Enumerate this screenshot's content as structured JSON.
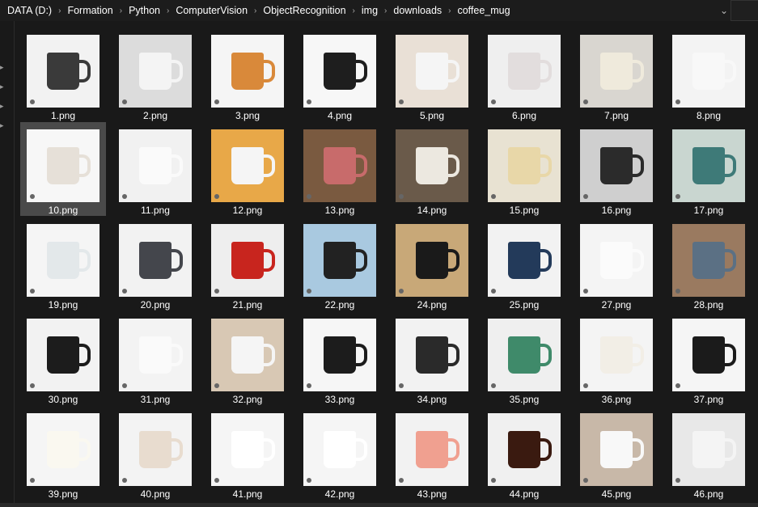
{
  "address_bar": {
    "breadcrumbs": [
      "DATA (D:)",
      "Formation",
      "Python",
      "ComputerVision",
      "ObjectRecognition",
      "img",
      "downloads",
      "coffee_mug"
    ],
    "dropdown_icon": "chevron-down-icon",
    "refresh_icon": "refresh-icon"
  },
  "selected": "10.png",
  "files": [
    {
      "name": "1.png",
      "bg": "#f2f2f2",
      "mug": "#3a3a3a"
    },
    {
      "name": "2.png",
      "bg": "#dcdcdc",
      "mug": "#f4f4f4"
    },
    {
      "name": "3.png",
      "bg": "#f5f5f5",
      "mug": "#d9893a"
    },
    {
      "name": "4.png",
      "bg": "#f7f7f7",
      "mug": "#1e1e1e"
    },
    {
      "name": "5.png",
      "bg": "#e9e0d6",
      "mug": "#f5f5f5"
    },
    {
      "name": "6.png",
      "bg": "#efefef",
      "mug": "#e2dddd"
    },
    {
      "name": "7.png",
      "bg": "#d9d6d0",
      "mug": "#efeadc"
    },
    {
      "name": "8.png",
      "bg": "#f3f3f3",
      "mug": "#f8f8f8"
    },
    {
      "name": "10.png",
      "bg": "#f7f7f7",
      "mug": "#e6e0d8"
    },
    {
      "name": "11.png",
      "bg": "#f1f1f1",
      "mug": "#fafafa"
    },
    {
      "name": "12.png",
      "bg": "#e8a848",
      "mug": "#f5f5f5"
    },
    {
      "name": "13.png",
      "bg": "#7a5a40",
      "mug": "#c86b6b"
    },
    {
      "name": "14.png",
      "bg": "#6a5a4a",
      "mug": "#ece8e0"
    },
    {
      "name": "15.png",
      "bg": "#e8e2d2",
      "mug": "#e8d7a8"
    },
    {
      "name": "16.png",
      "bg": "#cfcfcf",
      "mug": "#2b2b2b"
    },
    {
      "name": "17.png",
      "bg": "#c9d6d0",
      "mug": "#3e7a78"
    },
    {
      "name": "19.png",
      "bg": "#f5f5f5",
      "mug": "#e3e8ea"
    },
    {
      "name": "20.png",
      "bg": "#f2f2f2",
      "mug": "#44464c"
    },
    {
      "name": "21.png",
      "bg": "#eeeeee",
      "mug": "#c8251e"
    },
    {
      "name": "22.png",
      "bg": "#a9c9e0",
      "mug": "#222222"
    },
    {
      "name": "24.png",
      "bg": "#c8a878",
      "mug": "#1a1a1a"
    },
    {
      "name": "25.png",
      "bg": "#f2f2f2",
      "mug": "#233a5a"
    },
    {
      "name": "27.png",
      "bg": "#f4f4f4",
      "mug": "#fbfbfb"
    },
    {
      "name": "28.png",
      "bg": "#9a7a60",
      "mug": "#5b7084"
    },
    {
      "name": "30.png",
      "bg": "#f2f2f2",
      "mug": "#1c1c1c"
    },
    {
      "name": "31.png",
      "bg": "#f3f3f3",
      "mug": "#fafafa"
    },
    {
      "name": "32.png",
      "bg": "#d8c8b4",
      "mug": "#f5f5f5"
    },
    {
      "name": "33.png",
      "bg": "#f6f6f6",
      "mug": "#1c1c1c"
    },
    {
      "name": "34.png",
      "bg": "#f2f2f2",
      "mug": "#2a2a2a"
    },
    {
      "name": "35.png",
      "bg": "#efefef",
      "mug": "#3f8a6a"
    },
    {
      "name": "36.png",
      "bg": "#f4f4f4",
      "mug": "#f2eee6"
    },
    {
      "name": "37.png",
      "bg": "#f5f5f5",
      "mug": "#1b1b1b"
    },
    {
      "name": "39.png",
      "bg": "#f5f5f5",
      "mug": "#faf8f0"
    },
    {
      "name": "40.png",
      "bg": "#f3f3f3",
      "mug": "#e8dccf"
    },
    {
      "name": "41.png",
      "bg": "#f5f5f5",
      "mug": "#ffffff"
    },
    {
      "name": "42.png",
      "bg": "#f5f5f5",
      "mug": "#ffffff"
    },
    {
      "name": "43.png",
      "bg": "#f2f2f2",
      "mug": "#f0a090"
    },
    {
      "name": "44.png",
      "bg": "#f0f0f0",
      "mug": "#3a1a10"
    },
    {
      "name": "45.png",
      "bg": "#c8b8a8",
      "mug": "#f8f8f8"
    },
    {
      "name": "46.png",
      "bg": "#e8e8e8",
      "mug": "#f4f4f4"
    }
  ]
}
